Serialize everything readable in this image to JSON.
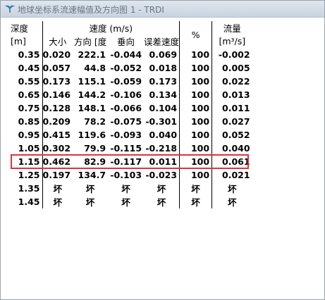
{
  "window": {
    "title": "地球坐标系流速幅值及方向图 1 - TRDI"
  },
  "table": {
    "header_row1": {
      "depth": "深度",
      "velocity": "速度 (m/s)",
      "percent": "%",
      "flow": "流量"
    },
    "header_row2": {
      "depth_unit": "[m]",
      "magnitude": "大小",
      "direction": "方向 [度",
      "vertical": "垂向",
      "error": "误差速度",
      "flow_unit": "[m³/s]"
    },
    "rows": [
      {
        "depth": "0.35",
        "mag": "0.020",
        "dir": "222.1",
        "vert": "-0.044",
        "err": "0.069",
        "pct": "100",
        "flow": "-0.002"
      },
      {
        "depth": "0.45",
        "mag": "0.057",
        "dir": "44.8",
        "vert": "-0.052",
        "err": "0.018",
        "pct": "100",
        "flow": "0.005"
      },
      {
        "depth": "0.55",
        "mag": "0.173",
        "dir": "115.1",
        "vert": "-0.059",
        "err": "0.173",
        "pct": "100",
        "flow": "0.022"
      },
      {
        "depth": "0.65",
        "mag": "0.146",
        "dir": "144.2",
        "vert": "-0.106",
        "err": "0.134",
        "pct": "100",
        "flow": "0.013"
      },
      {
        "depth": "0.75",
        "mag": "0.128",
        "dir": "148.1",
        "vert": "-0.066",
        "err": "0.104",
        "pct": "100",
        "flow": "0.011"
      },
      {
        "depth": "0.85",
        "mag": "0.209",
        "dir": "78.2",
        "vert": "-0.075",
        "err": "-0.301",
        "pct": "100",
        "flow": "0.027"
      },
      {
        "depth": "0.95",
        "mag": "0.415",
        "dir": "119.6",
        "vert": "-0.093",
        "err": "0.040",
        "pct": "100",
        "flow": "0.052"
      },
      {
        "depth": "1.05",
        "mag": "0.302",
        "dir": "79.9",
        "vert": "-0.115",
        "err": "-0.218",
        "pct": "100",
        "flow": "0.040"
      },
      {
        "depth": "1.15",
        "mag": "0.462",
        "dir": "82.9",
        "vert": "-0.117",
        "err": "0.011",
        "pct": "100",
        "flow": "0.061"
      },
      {
        "depth": "1.25",
        "mag": "0.197",
        "dir": "134.7",
        "vert": "-0.103",
        "err": "-0.023",
        "pct": "100",
        "flow": "0.021"
      },
      {
        "depth": "1.35",
        "mag": "坏",
        "dir": "坏",
        "vert": "坏",
        "err": "坏",
        "pct": "坏",
        "flow": "坏"
      },
      {
        "depth": "1.45",
        "mag": "坏",
        "dir": "坏",
        "vert": "坏",
        "err": "坏",
        "pct": "坏",
        "flow": "坏"
      }
    ],
    "bad_value": "坏",
    "highlighted_depth": "1.15"
  },
  "colors": {
    "bad_text": "#e11111",
    "highlight_border": "#d9363e",
    "title_text": "#6a7685"
  },
  "icons": {
    "app": "trdi-logo-icon"
  }
}
